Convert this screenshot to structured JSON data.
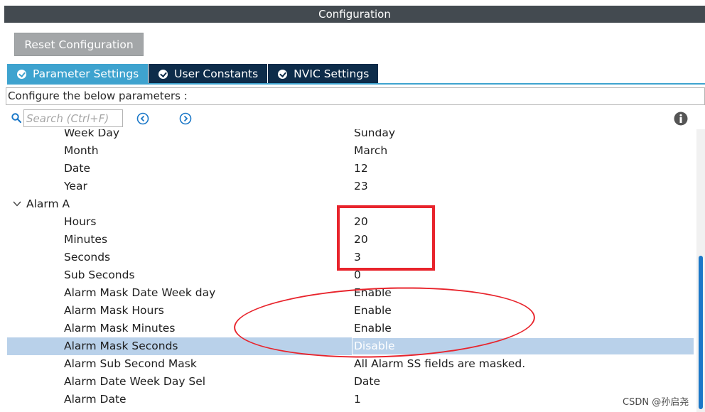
{
  "window": {
    "title": "Configuration"
  },
  "toolbar": {
    "reset_label": "Reset Configuration"
  },
  "tabs": [
    {
      "label": "Parameter Settings",
      "active": true
    },
    {
      "label": "User Constants",
      "active": false
    },
    {
      "label": "NVIC Settings",
      "active": false
    }
  ],
  "hint": "Configure the below parameters :",
  "search": {
    "placeholder": "Search (Ctrl+F)"
  },
  "tree": {
    "rows": [
      {
        "name": "Week Day",
        "value": "Sunday"
      },
      {
        "name": "Month",
        "value": "March"
      },
      {
        "name": "Date",
        "value": "12"
      },
      {
        "name": "Year",
        "value": "23"
      },
      {
        "group": "Alarm A"
      },
      {
        "name": "Hours",
        "value": "20"
      },
      {
        "name": "Minutes",
        "value": "20"
      },
      {
        "name": "Seconds",
        "value": "3"
      },
      {
        "name": "Sub Seconds",
        "value": "0"
      },
      {
        "name": "Alarm Mask Date Week day",
        "value": "Enable"
      },
      {
        "name": "Alarm Mask Hours",
        "value": "Enable"
      },
      {
        "name": "Alarm Mask Minutes",
        "value": "Enable"
      },
      {
        "name": "Alarm Mask Seconds",
        "value": "Disable",
        "selected": true
      },
      {
        "name": "Alarm Sub Second Mask",
        "value": "All Alarm SS fields are masked."
      },
      {
        "name": "Alarm Date Week Day Sel",
        "value": "Date"
      },
      {
        "name": "Alarm Date",
        "value": "1"
      }
    ]
  },
  "watermark": "CSDN @孙启尧",
  "colors": {
    "title_bar": "#434a50",
    "tab_active": "#3ea3cf",
    "tab_inactive": "#0d2c4a",
    "selected_row": "#b9d1ea",
    "annotation": "#e8242c",
    "scroll_thumb": "#1b78c8"
  },
  "icons": {
    "search": "search-icon",
    "prev": "circle-arrow-left-icon",
    "next": "circle-arrow-right-icon",
    "info": "info-icon",
    "tab_check": "check-circle-icon",
    "expand": "chevron-down-icon"
  }
}
